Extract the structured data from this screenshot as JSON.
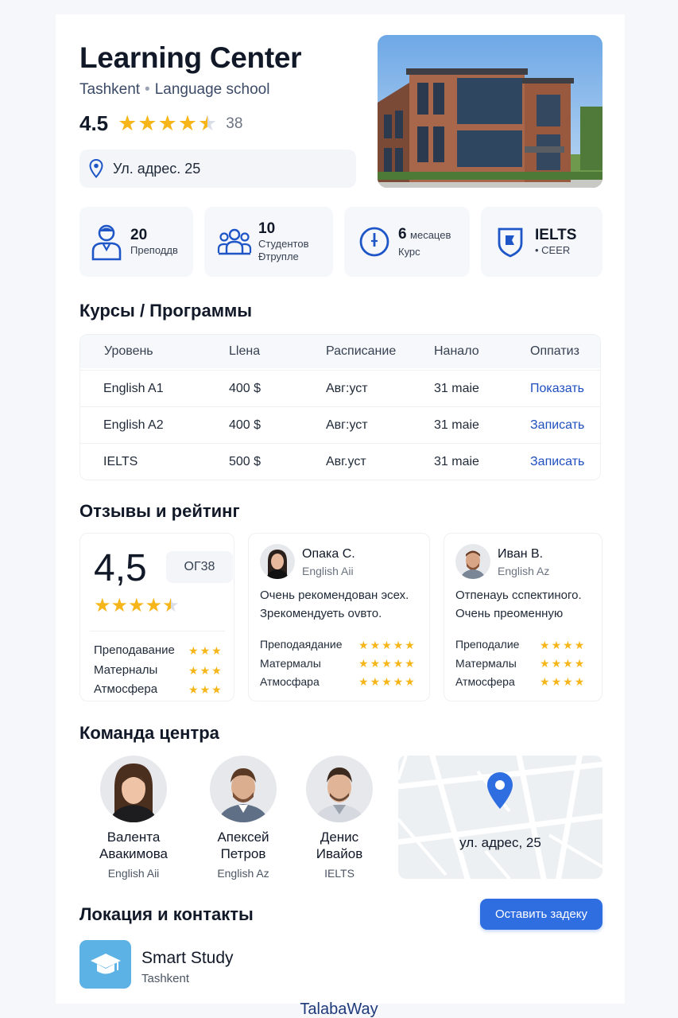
{
  "header": {
    "title": "Learning Center",
    "city": "Tashkent",
    "type": "Language school",
    "rating": "4.5",
    "rating_value": 4.5,
    "rating_count": "38",
    "address": "Ул. адрес. 25"
  },
  "stats": [
    {
      "icon": "teacher-icon",
      "value": "20",
      "label": "Преподдв"
    },
    {
      "icon": "group-icon",
      "value": "10",
      "label": "Студентов",
      "label2": "Ðтрупле"
    },
    {
      "icon": "clock-icon",
      "value": "6",
      "value_suffix": "месацев",
      "label": "Курс"
    },
    {
      "icon": "shield-icon",
      "value": "IELTS",
      "label": "• CEER"
    }
  ],
  "courses": {
    "heading": "Курсы / Программы",
    "columns": [
      "Уровень",
      "Lleна",
      "Расписание",
      "Нанало",
      "Оппатиз"
    ],
    "rows": [
      {
        "level": "English A1",
        "price": "400 $",
        "schedule": "Авг:уст",
        "start": "31 maie",
        "action": "Показать"
      },
      {
        "level": "English A2",
        "price": "400 $",
        "schedule": "Авг:уст",
        "start": "31 maie",
        "action": "Записать"
      },
      {
        "level": "IELTS",
        "price": "500 $",
        "schedule": "Авг.уст",
        "start": "31 maie",
        "action": "Записать"
      }
    ]
  },
  "reviews": {
    "heading": "Отзывы и рейтинг",
    "overall": "4,5",
    "overall_value": 4.5,
    "count_badge": "ОГ38",
    "criteria": [
      {
        "label": "Преподавание",
        "stars": 3
      },
      {
        "label": "Матерналы",
        "stars": 3
      },
      {
        "label": "Атмосфера",
        "stars": 3
      }
    ],
    "items": [
      {
        "name": "Опака С.",
        "course": "English Aii",
        "text1": "Очень рекомендован эсех.",
        "text2": "Зрекомендуеть ovвто.",
        "criteria": [
          {
            "label": "Преподаядание",
            "stars": 5
          },
          {
            "label": "Матермалы",
            "stars": 5
          },
          {
            "label": "Атмосфара",
            "stars": 5
          }
        ]
      },
      {
        "name": "Иван В.",
        "course": "English Az",
        "text1": "Отпенауь сспектиного.",
        "text2": "Очень преоменную",
        "criteria": [
          {
            "label": "Преподалие",
            "stars": 4
          },
          {
            "label": "Матермалы",
            "stars": 4
          },
          {
            "label": "Атмосфера",
            "stars": 4
          }
        ]
      }
    ]
  },
  "team": {
    "heading": "Команда центра",
    "members": [
      {
        "first": "Валента",
        "last": "Авакимова",
        "role": "English Aii"
      },
      {
        "first": "Апексей",
        "last": "Петров",
        "role": "English Az"
      },
      {
        "first": "Денис",
        "last": "Ивайов",
        "role": "IELTS"
      }
    ],
    "map_label": "ул. адрес, 25"
  },
  "contacts": {
    "heading": "Локация и контакты",
    "cta": "Оставить задеку",
    "brand": "Smart Study",
    "brand_city": "Tashkent"
  },
  "footer": "TalabaWay",
  "colors": {
    "accent": "#2f6ee0",
    "star": "#f6b619",
    "link": "#1f4fbf",
    "icon_blue": "#1e56c8",
    "logo_bg": "#5cb2e5"
  }
}
